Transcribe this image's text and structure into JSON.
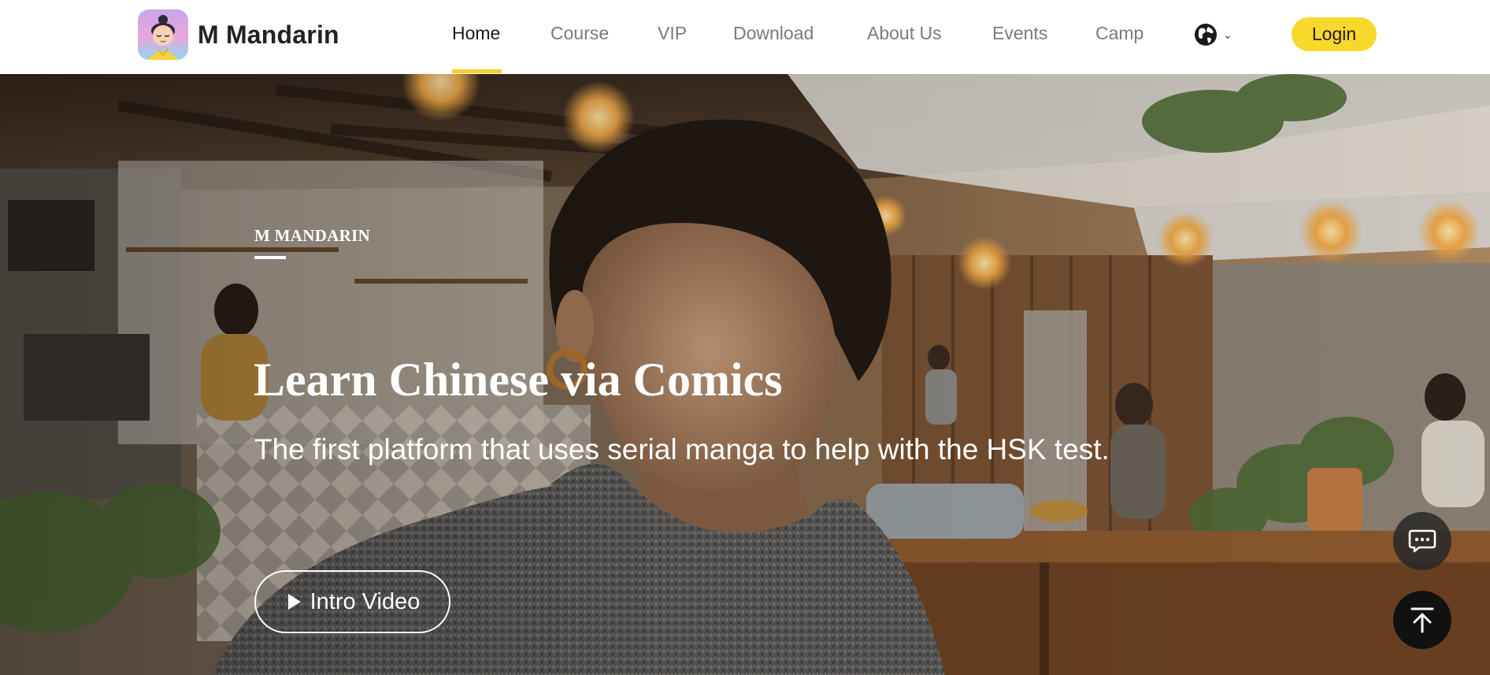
{
  "header": {
    "logo_text": "M Mandarin",
    "nav": [
      "Home",
      "Course",
      "VIP",
      "Download",
      "About Us",
      "Events",
      "Camp"
    ],
    "active_nav": "Home",
    "language_icon": "globe-icon",
    "login_label": "Login",
    "accent_color": "#f9d82c"
  },
  "hero": {
    "brand_label": "M MANDARIN",
    "title": "Learn Chinese via Comics",
    "subtitle": "The first platform that uses serial manga to help with the HSK test.",
    "intro_video_label": "Intro Video"
  },
  "floating": {
    "chat_icon": "chat-icon",
    "back_to_top_icon": "arrow-up-icon"
  }
}
